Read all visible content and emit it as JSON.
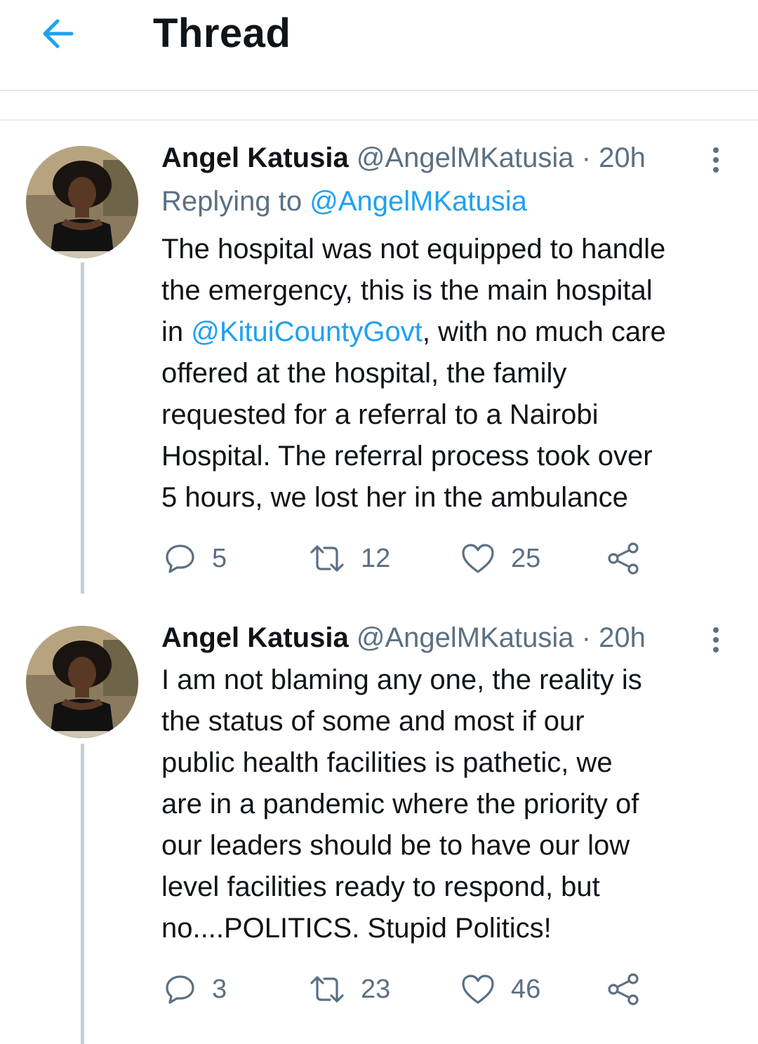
{
  "header": {
    "title": "Thread",
    "back_icon": "arrow-left-icon",
    "accent": "#1da1f2"
  },
  "tweets": [
    {
      "name": "Angel Katusia",
      "handle": "@AngelMKatusia",
      "dot": "·",
      "time": "20h",
      "reply_label": "Replying to",
      "reply_handle": "@AngelMKatusia",
      "text_before": "The hospital was not equipped to handle\nthe emergency, this is the main hospital\nin ",
      "text_mention": "@KituiCountyGovt",
      "text_after": ", with no much care\noffered at the hospital, the family\nrequested for a referral  to a Nairobi\nHospital.  The referral  process took over\n5 hours, we lost her in the ambulance",
      "replies": "5",
      "retweets": "12",
      "likes": "25"
    },
    {
      "name": "Angel Katusia",
      "handle": "@AngelMKatusia",
      "dot": "·",
      "time": "20h",
      "text": "I am not blaming any one,  the reality is\nthe status of some and most if our\npublic  health facilities is pathetic, we\nare in a pandemic where the priority of\nour leaders should be  to have our low\nlevel facilities  ready to respond,  but\nno....POLITICS. Stupid Politics!",
      "replies": "3",
      "retweets": "23",
      "likes": "46"
    }
  ]
}
